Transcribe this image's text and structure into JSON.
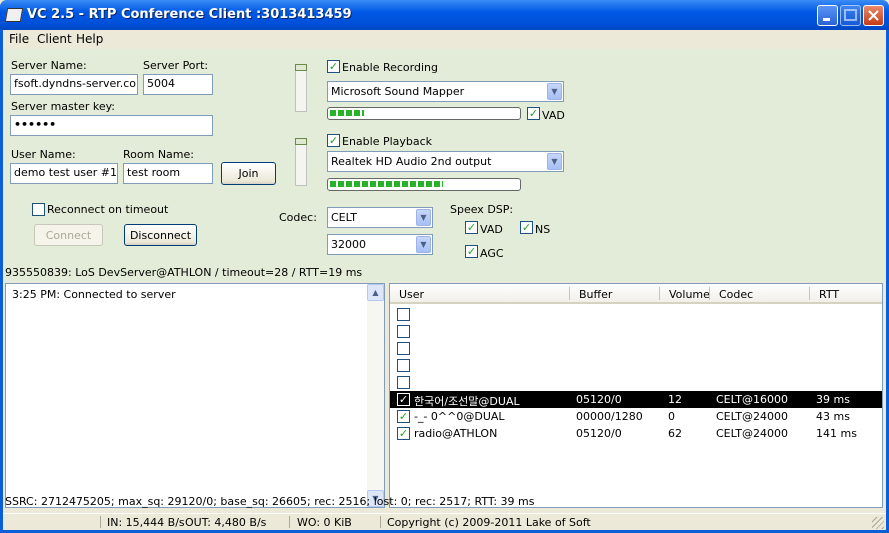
{
  "window": {
    "title": "VC 2.5 - RTP Conference Client :3013413459"
  },
  "menu": [
    "File",
    "Client",
    "Help"
  ],
  "server": {
    "name_label": "Server Name:",
    "name_value": "fsoft.dyndns-server.com",
    "port_label": "Server Port:",
    "port_value": "5004",
    "key_label": "Server master key:",
    "key_value": "••••••",
    "user_label": "User Name:",
    "user_value": "demo test user #1",
    "room_label": "Room Name:",
    "room_value": "test room",
    "join_label": "Join",
    "reconnect_label": "Reconnect on timeout",
    "reconnect_checked": false,
    "connect_label": "Connect",
    "disconnect_label": "Disconnect"
  },
  "recording": {
    "enable_label": "Enable Recording",
    "enabled": true,
    "device": "Microsoft Sound Mapper",
    "level": 0.18,
    "vad_label": "VAD",
    "vad_checked": true
  },
  "playback": {
    "enable_label": "Enable Playback",
    "enabled": true,
    "device": "Realtek HD Audio 2nd output",
    "level": 0.6
  },
  "codec": {
    "label": "Codec:",
    "value": "CELT",
    "rate": "32000"
  },
  "speex": {
    "label": "Speex DSP:",
    "vad_label": "VAD",
    "ns_label": "NS",
    "agc_label": "AGC"
  },
  "status_line": "935550839: LoS DevServer@ATHLON /  timeout=28 / RTT=19 ms",
  "log": [
    "3:25 PM: Connected to server"
  ],
  "users": {
    "columns": [
      "User",
      "Buffer",
      "Volume",
      "Codec",
      "RTT"
    ],
    "rows": [
      {
        "checked": false,
        "user": "",
        "buffer": "",
        "volume": "",
        "codec": "",
        "rtt": ""
      },
      {
        "checked": false,
        "user": "",
        "buffer": "",
        "volume": "",
        "codec": "",
        "rtt": ""
      },
      {
        "checked": false,
        "user": "",
        "buffer": "",
        "volume": "",
        "codec": "",
        "rtt": ""
      },
      {
        "checked": false,
        "user": "",
        "buffer": "",
        "volume": "",
        "codec": "",
        "rtt": ""
      },
      {
        "checked": false,
        "user": "",
        "buffer": "",
        "volume": "",
        "codec": "",
        "rtt": ""
      },
      {
        "checked": true,
        "selected": true,
        "user": "한국어/조선말@DUAL",
        "buffer": "05120/0",
        "volume": "12",
        "codec": "CELT@16000",
        "rtt": "39 ms"
      },
      {
        "checked": true,
        "user": "-_- 0^^0@DUAL",
        "buffer": "00000/1280",
        "volume": "0",
        "codec": "CELT@24000",
        "rtt": "43 ms"
      },
      {
        "checked": true,
        "user": "radio@ATHLON",
        "buffer": "05120/0",
        "volume": "62",
        "codec": "CELT@24000",
        "rtt": "141 ms"
      }
    ]
  },
  "ssrc_line": "SSRC: 2712475205; max_sq: 29120/0; base_sq: 26605; rec: 2516; lost: 0; rec: 2517; RTT: 39 ms",
  "statusbar": {
    "in": "IN: 15,444 B/s",
    "out": "OUT: 4,480 B/s",
    "wo": "WO: 0 KiB",
    "copyright": "Copyright (c) 2009-2011 Lake of Soft"
  }
}
